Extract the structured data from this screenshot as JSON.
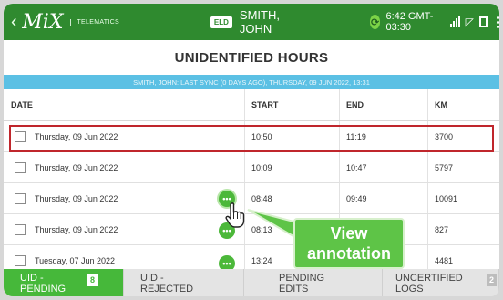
{
  "status_bar": {
    "brand": "MiX",
    "brand_sub": "TELEMATICS",
    "eld_badge": "ELD",
    "driver_name": "SMITH, JOHN",
    "sync_icon": "sync-status-icon",
    "clock": "6:42 GMT-03:30",
    "icons": [
      "back-chevron-icon",
      "signal-icon",
      "wifi-icon",
      "document-icon",
      "overflow-menu-icon"
    ]
  },
  "page": {
    "title": "UNIDENTIFIED HOURS",
    "sync_banner": "SMITH, JOHN: LAST SYNC (0 DAYS AGO), THURSDAY, 09 JUN 2022, 13:31"
  },
  "table": {
    "headers": {
      "date": "DATE",
      "start": "START",
      "end": "END",
      "km": "KM"
    },
    "rows": [
      {
        "date": "Thursday, 09 Jun 2022",
        "start": "10:50",
        "end": "11:19",
        "km": "3700",
        "has_note": false
      },
      {
        "date": "Thursday, 09 Jun 2022",
        "start": "10:09",
        "end": "10:47",
        "km": "5797",
        "has_note": false
      },
      {
        "date": "Thursday, 09 Jun 2022",
        "start": "08:48",
        "end": "09:49",
        "km": "10091",
        "has_note": true
      },
      {
        "date": "Thursday, 09 Jun 2022",
        "start": "08:13",
        "end": "",
        "km": "827",
        "has_note": true
      },
      {
        "date": "Tuesday, 07 Jun 2022",
        "start": "13:24",
        "end": "",
        "km": "4481",
        "has_note": true
      }
    ],
    "selected_row": 1
  },
  "callout": {
    "line1": "View",
    "line2": "annotation"
  },
  "tabs": [
    {
      "line1": "UID -",
      "line2": "PENDING",
      "count": "8",
      "active": true
    },
    {
      "line1": "UID -",
      "line2": "REJECTED",
      "count": "",
      "active": false
    },
    {
      "line1": "PENDING",
      "line2": "EDITS",
      "count": "",
      "active": false
    },
    {
      "line1": "UNCERTIFIED",
      "line2": "LOGS",
      "count": "2",
      "active": false
    }
  ],
  "colors": {
    "status_bar": "#2f8a2f",
    "banner": "#5bc0e4",
    "accent_green": "#46b83a",
    "selection_border": "#c0262c"
  }
}
